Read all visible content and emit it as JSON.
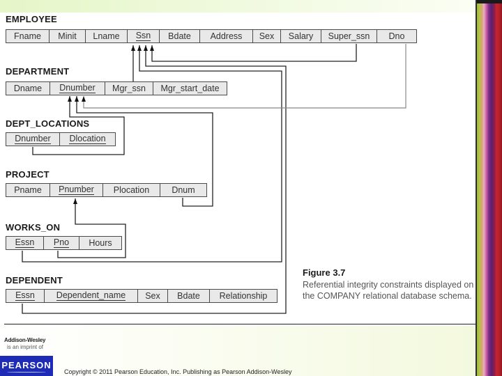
{
  "figure": {
    "title": "Figure 3.7",
    "caption": "Referential integrity constraints displayed on the COMPANY relational database schema."
  },
  "relations": {
    "employee": {
      "name": "EMPLOYEE",
      "attributes": [
        {
          "label": "Fname",
          "pk": false
        },
        {
          "label": "Minit",
          "pk": false
        },
        {
          "label": "Lname",
          "pk": false
        },
        {
          "label": "Ssn",
          "pk": true
        },
        {
          "label": "Bdate",
          "pk": false
        },
        {
          "label": "Address",
          "pk": false
        },
        {
          "label": "Sex",
          "pk": false
        },
        {
          "label": "Salary",
          "pk": false
        },
        {
          "label": "Super_ssn",
          "pk": false
        },
        {
          "label": "Dno",
          "pk": false
        }
      ]
    },
    "department": {
      "name": "DEPARTMENT",
      "attributes": [
        {
          "label": "Dname",
          "pk": false
        },
        {
          "label": "Dnumber",
          "pk": true
        },
        {
          "label": "Mgr_ssn",
          "pk": false
        },
        {
          "label": "Mgr_start_date",
          "pk": false
        }
      ]
    },
    "dept_locations": {
      "name": "DEPT_LOCATIONS",
      "attributes": [
        {
          "label": "Dnumber",
          "pk": true
        },
        {
          "label": "Dlocation",
          "pk": true
        }
      ]
    },
    "project": {
      "name": "PROJECT",
      "attributes": [
        {
          "label": "Pname",
          "pk": false
        },
        {
          "label": "Pnumber",
          "pk": true
        },
        {
          "label": "Plocation",
          "pk": false
        },
        {
          "label": "Dnum",
          "pk": false
        }
      ]
    },
    "works_on": {
      "name": "WORKS_ON",
      "attributes": [
        {
          "label": "Essn",
          "pk": true
        },
        {
          "label": "Pno",
          "pk": true
        },
        {
          "label": "Hours",
          "pk": false
        }
      ]
    },
    "dependent": {
      "name": "DEPENDENT",
      "attributes": [
        {
          "label": "Essn",
          "pk": true
        },
        {
          "label": "Dependent_name",
          "pk": true
        },
        {
          "label": "Sex",
          "pk": false
        },
        {
          "label": "Bdate",
          "pk": false
        },
        {
          "label": "Relationship",
          "pk": false
        }
      ]
    }
  },
  "references": [
    {
      "from": "DEPARTMENT.Mgr_ssn",
      "to": "EMPLOYEE.Ssn"
    },
    {
      "from": "WORKS_ON.Essn",
      "to": "EMPLOYEE.Ssn"
    },
    {
      "from": "DEPENDENT.Essn",
      "to": "EMPLOYEE.Ssn"
    },
    {
      "from": "EMPLOYEE.Super_ssn",
      "to": "EMPLOYEE.Ssn"
    },
    {
      "from": "DEPT_LOCATIONS.Dnumber",
      "to": "DEPARTMENT.Dnumber"
    },
    {
      "from": "PROJECT.Dnum",
      "to": "DEPARTMENT.Dnumber"
    },
    {
      "from": "EMPLOYEE.Dno",
      "to": "DEPARTMENT.Dnumber"
    },
    {
      "from": "WORKS_ON.Pno",
      "to": "PROJECT.Pnumber"
    }
  ],
  "footer": {
    "publisher_logo": "Addison-Wesley",
    "publisher_sub": "is an imprint of",
    "brand": "PEARSON",
    "copyright": "Copyright © 2011 Pearson Education, Inc. Publishing as Pearson Addison-Wesley"
  }
}
